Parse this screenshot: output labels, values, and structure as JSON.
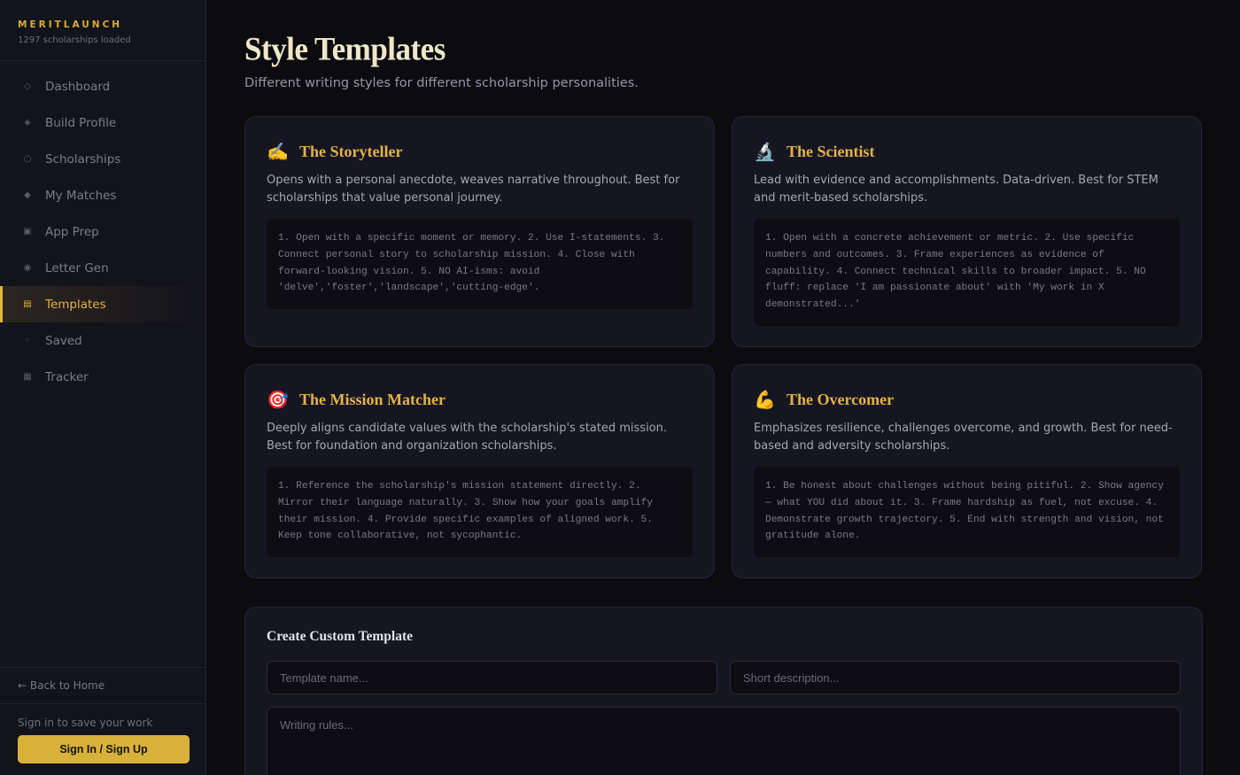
{
  "brand": {
    "name": "MERITLAUNCH",
    "subtitle": "1297 scholarships loaded"
  },
  "sidebar": {
    "items": [
      {
        "label": "Dashboard",
        "icon": "diamond-outline-icon",
        "glyph": "◇"
      },
      {
        "label": "Build Profile",
        "icon": "diamond-dot-icon",
        "glyph": "◈"
      },
      {
        "label": "Scholarships",
        "icon": "circle-outline-icon",
        "glyph": "○"
      },
      {
        "label": "My Matches",
        "icon": "diamond-filled-icon",
        "glyph": "◆"
      },
      {
        "label": "App Prep",
        "icon": "square-dot-icon",
        "glyph": "▣"
      },
      {
        "label": "Letter Gen",
        "icon": "circle-dot-icon",
        "glyph": "◉"
      },
      {
        "label": "Templates",
        "icon": "template-icon",
        "glyph": "▤",
        "active": true
      },
      {
        "label": "Saved",
        "icon": "small-dot-icon",
        "glyph": "◦"
      },
      {
        "label": "Tracker",
        "icon": "grid-square-icon",
        "glyph": "▦"
      }
    ],
    "back_home": "← Back to Home",
    "signin_prompt": "Sign in to save your work",
    "signin_button": "Sign In / Sign Up"
  },
  "main": {
    "title": "Style Templates",
    "subtitle": "Different writing styles for different scholarship personalities.",
    "templates": [
      {
        "emoji": "✍️",
        "icon": "writing-hand-icon",
        "title": "The Storyteller",
        "description": "Opens with a personal anecdote, weaves narrative throughout. Best for scholarships that value personal journey.",
        "rules": "1. Open with a specific moment or memory. 2. Use I-statements. 3. Connect personal story to scholarship mission. 4. Close with forward-looking vision. 5. NO AI-isms: avoid 'delve','foster','landscape','cutting-edge'."
      },
      {
        "emoji": "🔬",
        "icon": "microscope-icon",
        "title": "The Scientist",
        "description": "Lead with evidence and accomplishments. Data-driven. Best for STEM and merit-based scholarships.",
        "rules": "1. Open with a concrete achievement or metric. 2. Use specific numbers and outcomes. 3. Frame experiences as evidence of capability. 4. Connect technical skills to broader impact. 5. NO fluff: replace 'I am passionate about' with 'My work in X demonstrated...'"
      },
      {
        "emoji": "🎯",
        "icon": "target-icon",
        "title": "The Mission Matcher",
        "description": "Deeply aligns candidate values with the scholarship's stated mission. Best for foundation and organization scholarships.",
        "rules": "1. Reference the scholarship's mission statement directly. 2. Mirror their language naturally. 3. Show how your goals amplify their mission. 4. Provide specific examples of aligned work. 5. Keep tone collaborative, not sycophantic."
      },
      {
        "emoji": "💪",
        "icon": "flexed-biceps-icon",
        "title": "The Overcomer",
        "description": "Emphasizes resilience, challenges overcome, and growth. Best for need-based and adversity scholarships.",
        "rules": "1. Be honest about challenges without being pitiful. 2. Show agency — what YOU did about it. 3. Frame hardship as fuel, not excuse. 4. Demonstrate growth trajectory. 5. End with strength and vision, not gratitude alone."
      }
    ],
    "custom": {
      "title": "Create Custom Template",
      "name_placeholder": "Template name...",
      "desc_placeholder": "Short description...",
      "rules_placeholder": "Writing rules..."
    }
  },
  "colors": {
    "accent": "#e2b33c",
    "background": "#0b0b10",
    "card": "#161622"
  }
}
